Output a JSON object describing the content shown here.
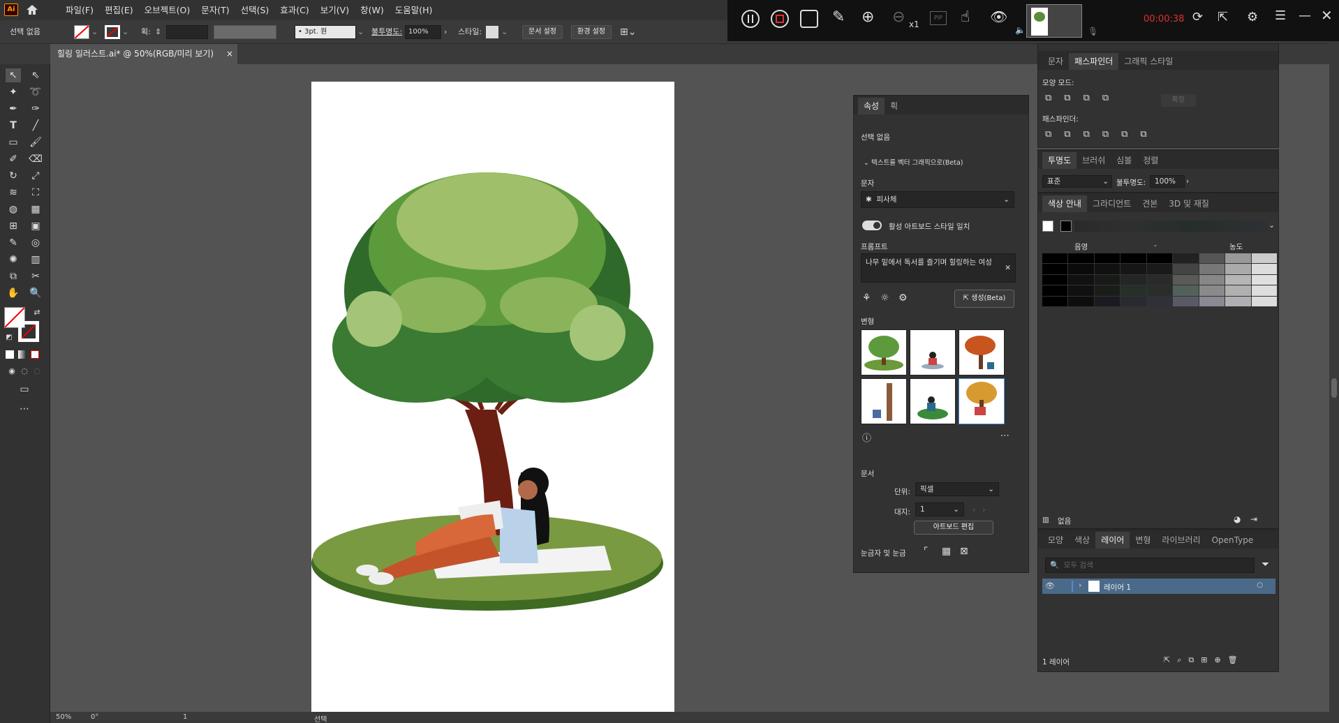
{
  "menubar": {
    "logo": "Ai",
    "items": [
      "파일(F)",
      "편집(E)",
      "오브젝트(O)",
      "문자(T)",
      "선택(S)",
      "효과(C)",
      "보기(V)",
      "창(W)",
      "도움말(H)"
    ]
  },
  "control": {
    "selection": "선택 없음",
    "stroke_label": "획:",
    "brush": "3pt. 원",
    "opacity_label": "불투명도:",
    "opacity_value": "100%",
    "style_label": "스타일:",
    "doc_setup": "문서 설정",
    "prefs": "환경 설정"
  },
  "recorder": {
    "speed": "x1",
    "pip": "PIP",
    "time": "00:00:38"
  },
  "document": {
    "tab": "힐링 일러스트.ai* @ 50%(RGB/미리 보기)"
  },
  "status": {
    "zoom": "50%",
    "rotate": "0°",
    "page": "1",
    "mode": "선택"
  },
  "properties": {
    "tabs": [
      "속성",
      "획"
    ],
    "selection": "선택 없음",
    "text_to_vector": "텍스트를 벡터 그래픽으로(Beta)",
    "type_label": "문자",
    "type_value": "피사체",
    "match_style": "활성 아트보드 스타일 일치",
    "prompt_label": "프롬프트",
    "prompt_value": "나무 밑에서 독서를 즐기며 힐링하는 여성",
    "generate": "생성(Beta)",
    "variations_label": "변형",
    "document_label": "문서",
    "units_label": "단위:",
    "units_value": "픽셀",
    "artboard_label": "대지:",
    "artboard_value": "1",
    "edit_artboards": "아트보드 편집",
    "rulers_label": "눈금자 및 눈금"
  },
  "pathfinder": {
    "tabs": [
      "문자",
      "패스파인더",
      "그래픽 스타일"
    ],
    "shape_modes": "모양 모드:",
    "expand": "확장",
    "pathfinders": "패스파인더:"
  },
  "transparency": {
    "tabs": [
      "투명도",
      "브러쉬",
      "심볼",
      "정렬"
    ],
    "mode": "표준",
    "opacity_label": "불투명도:",
    "opacity_value": "100%"
  },
  "color_guide": {
    "tabs": [
      "색상 안내",
      "그라디언트",
      "견본",
      "3D 및 재질"
    ],
    "shade": "음영",
    "tint": "농도",
    "none": "없음"
  },
  "layers": {
    "tabs": [
      "모양",
      "색상",
      "레이어",
      "변형",
      "라이브러리",
      "OpenType"
    ],
    "search_placeholder": "모두 검색",
    "layer_name": "레이어 1",
    "count": "1 레이어"
  },
  "colors": {
    "accent": "#4a90d9",
    "record_time": "#e03030"
  }
}
